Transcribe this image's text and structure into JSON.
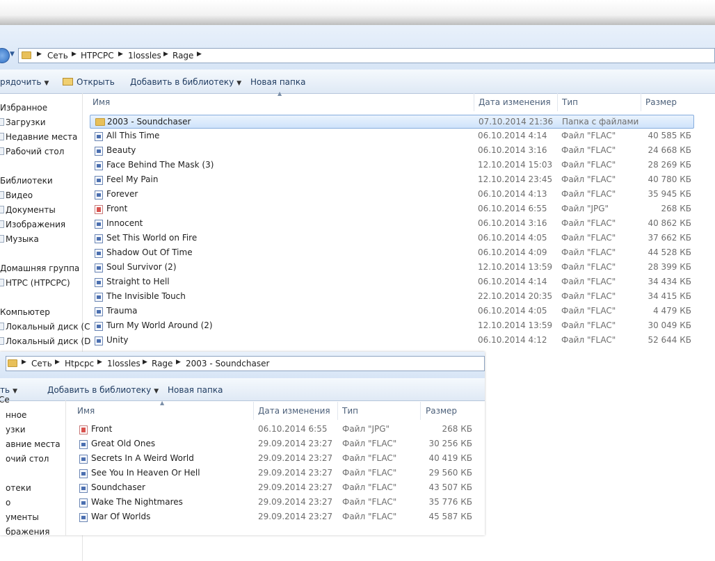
{
  "main": {
    "breadcrumb": [
      "Сеть",
      "HTPCPC",
      "1lossles",
      "Rage"
    ],
    "toolbar": {
      "organize": "рядочить",
      "open": "Открыть",
      "add_library": "Добавить в библиотеку",
      "new_folder": "Новая папка"
    },
    "columns": {
      "name": "Имя",
      "date": "Дата изменения",
      "type": "Тип",
      "size": "Размер"
    },
    "nav": [
      {
        "label": "Избранное"
      },
      {
        "label": "Загрузки"
      },
      {
        "label": "Недавние места"
      },
      {
        "label": "Рабочий стол"
      },
      {
        "label": "Библиотеки"
      },
      {
        "label": "Видео"
      },
      {
        "label": "Документы"
      },
      {
        "label": "Изображения"
      },
      {
        "label": "Музыка"
      },
      {
        "label": "Домашняя группа"
      },
      {
        "label": "HTPC (HTPCPC)"
      },
      {
        "label": "Компьютер"
      },
      {
        "label": "Локальный диск (C"
      },
      {
        "label": "Локальный диск (D"
      }
    ],
    "files": [
      {
        "name": "2003 - Soundchaser",
        "date": "07.10.2014 21:36",
        "type": "Папка с файлами",
        "size": "",
        "icon": "folder-icon"
      },
      {
        "name": "All This Time",
        "date": "06.10.2014 4:14",
        "type": "Файл \"FLAC\"",
        "size": "40 585 КБ",
        "icon": "flac-file-icon"
      },
      {
        "name": "Beauty",
        "date": "06.10.2014 3:16",
        "type": "Файл \"FLAC\"",
        "size": "24 668 КБ",
        "icon": "flac-file-icon"
      },
      {
        "name": "Face Behind The Mask (3)",
        "date": "12.10.2014 15:03",
        "type": "Файл \"FLAC\"",
        "size": "28 269 КБ",
        "icon": "flac-file-icon"
      },
      {
        "name": "Feel My Pain",
        "date": "12.10.2014 23:45",
        "type": "Файл \"FLAC\"",
        "size": "40 780 КБ",
        "icon": "flac-file-icon"
      },
      {
        "name": "Forever",
        "date": "06.10.2014 4:13",
        "type": "Файл \"FLAC\"",
        "size": "35 945 КБ",
        "icon": "flac-file-icon"
      },
      {
        "name": "Front",
        "date": "06.10.2014 6:55",
        "type": "Файл \"JPG\"",
        "size": "268 КБ",
        "icon": "jpg-file-icon"
      },
      {
        "name": "Innocent",
        "date": "06.10.2014 3:16",
        "type": "Файл \"FLAC\"",
        "size": "40 862 КБ",
        "icon": "flac-file-icon"
      },
      {
        "name": "Set This World on Fire",
        "date": "06.10.2014 4:05",
        "type": "Файл \"FLAC\"",
        "size": "37 662 КБ",
        "icon": "flac-file-icon"
      },
      {
        "name": "Shadow Out Of Time",
        "date": "06.10.2014 4:09",
        "type": "Файл \"FLAC\"",
        "size": "44 528 КБ",
        "icon": "flac-file-icon"
      },
      {
        "name": "Soul Survivor (2)",
        "date": "12.10.2014 13:59",
        "type": "Файл \"FLAC\"",
        "size": "28 399 КБ",
        "icon": "flac-file-icon"
      },
      {
        "name": "Straight to Hell",
        "date": "06.10.2014 4:14",
        "type": "Файл \"FLAC\"",
        "size": "34 434 КБ",
        "icon": "flac-file-icon"
      },
      {
        "name": "The Invisible Touch",
        "date": "22.10.2014 20:35",
        "type": "Файл \"FLAC\"",
        "size": "34 415 КБ",
        "icon": "flac-file-icon"
      },
      {
        "name": "Trauma",
        "date": "06.10.2014 4:05",
        "type": "Файл \"FLAC\"",
        "size": "4 479 КБ",
        "icon": "flac-file-icon"
      },
      {
        "name": "Turn My World Around (2)",
        "date": "12.10.2014 13:59",
        "type": "Файл \"FLAC\"",
        "size": "30 049 КБ",
        "icon": "flac-file-icon"
      },
      {
        "name": "Unity",
        "date": "06.10.2014 4:12",
        "type": "Файл \"FLAC\"",
        "size": "52 644 КБ",
        "icon": "flac-file-icon"
      }
    ]
  },
  "sub": {
    "breadcrumb": [
      "Сеть",
      "Htpcpc",
      "1lossles",
      "Rage",
      "2003 - Soundchaser"
    ],
    "toolbar": {
      "organize": "ть",
      "add_library": "Добавить в библиотеку",
      "new_folder": "Новая папка"
    },
    "columns": {
      "name": "Имя",
      "date": "Дата изменения",
      "type": "Тип",
      "size": "Размер"
    },
    "nav": [
      {
        "label": "Се"
      },
      {
        "label": "нное"
      },
      {
        "label": "узки"
      },
      {
        "label": "авние места"
      },
      {
        "label": "очий стол"
      },
      {
        "label": "отеки"
      },
      {
        "label": "о"
      },
      {
        "label": "ументы"
      },
      {
        "label": "бражения"
      }
    ],
    "files": [
      {
        "name": "Front",
        "date": "06.10.2014 6:55",
        "type": "Файл \"JPG\"",
        "size": "268 КБ",
        "icon": "jpg-file-icon"
      },
      {
        "name": "Great Old Ones",
        "date": "29.09.2014 23:27",
        "type": "Файл \"FLAC\"",
        "size": "30 256 КБ",
        "icon": "flac-file-icon"
      },
      {
        "name": "Secrets In A Weird World",
        "date": "29.09.2014 23:27",
        "type": "Файл \"FLAC\"",
        "size": "40 419 КБ",
        "icon": "flac-file-icon"
      },
      {
        "name": "See You In Heaven Or Hell",
        "date": "29.09.2014 23:27",
        "type": "Файл \"FLAC\"",
        "size": "29 560 КБ",
        "icon": "flac-file-icon"
      },
      {
        "name": "Soundchaser",
        "date": "29.09.2014 23:27",
        "type": "Файл \"FLAC\"",
        "size": "43 507 КБ",
        "icon": "flac-file-icon"
      },
      {
        "name": "Wake The Nightmares",
        "date": "29.09.2014 23:27",
        "type": "Файл \"FLAC\"",
        "size": "35 776 КБ",
        "icon": "flac-file-icon"
      },
      {
        "name": "War Of Worlds",
        "date": "29.09.2014 23:27",
        "type": "Файл \"FLAC\"",
        "size": "45 587 КБ",
        "icon": "flac-file-icon"
      }
    ]
  }
}
